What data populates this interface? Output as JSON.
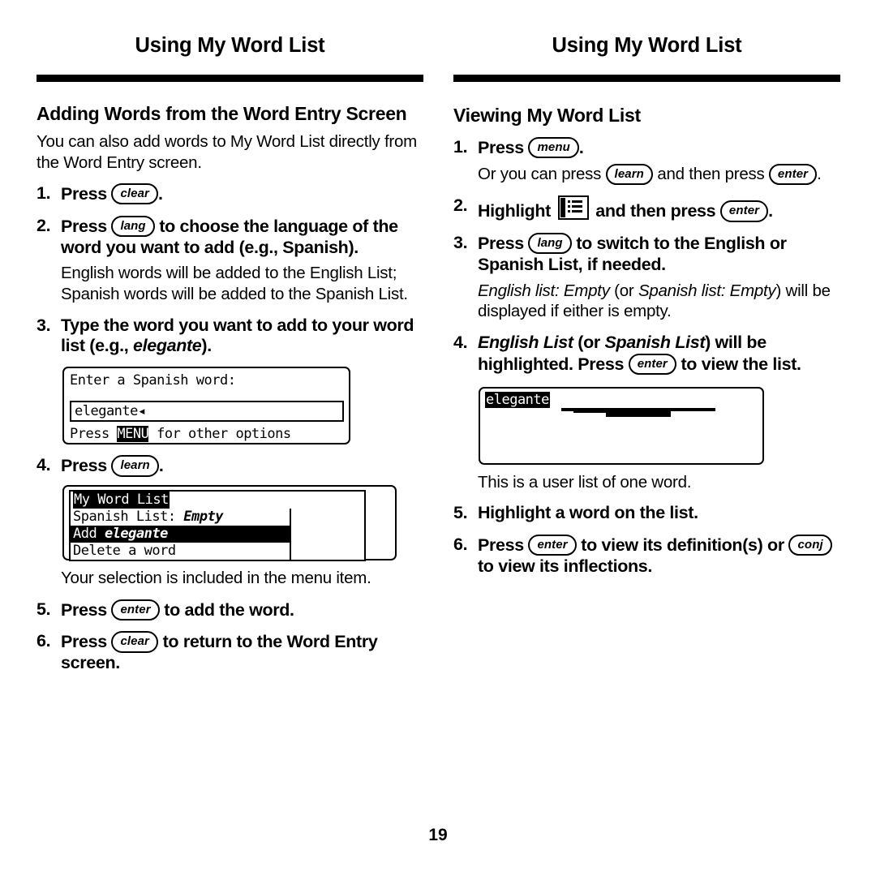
{
  "page": {
    "folio": "19",
    "running_head_left": "Using My Word List",
    "running_head_right": "Using My Word List"
  },
  "left_column": {
    "section_heading": "Adding Words from the Word Entry Screen",
    "intro": "You can also add words to My Word List directly from the Word Entry screen.",
    "steps": [
      {
        "num": "1.",
        "prefix": "Press ",
        "key": "clear",
        "suffix": "."
      },
      {
        "num": "2.",
        "prefix": "Press ",
        "key": "lang",
        "suffix": " to choose the language of the word you want to add (e.g., Spanish).",
        "note": "English words will be added to the English List; Spanish words will be added to the Spanish List."
      },
      {
        "num": "3.",
        "prefix": "Type the word you want to add to your word list (e.g., ",
        "italic": "elegante",
        "suffix": ")."
      },
      {
        "num": "4.",
        "prefix": "Press ",
        "key": "learn",
        "suffix": "."
      },
      {
        "num": "5.",
        "prefix": "Press ",
        "key": "enter",
        "suffix": " to add the word."
      },
      {
        "num": "6.",
        "prefix": "Press ",
        "key": "clear",
        "suffix": " to return to the Word Entry screen."
      }
    ],
    "caption_menu": "Your selection is included in the menu item.",
    "screen_word_entry": {
      "prompt": "Enter a Spanish word:",
      "field_value": "elegante◂",
      "footer_before": "Press ",
      "footer_key": "MENU",
      "footer_after": " for other options"
    },
    "screen_menu": {
      "title": "My Word List",
      "items": [
        {
          "label_before": "Spanish List: ",
          "label_italic": "Empty",
          "selected": false
        },
        {
          "label_before": "Add ",
          "label_italic": "elegante",
          "selected": true
        },
        {
          "label_before": "Delete a word",
          "label_italic": "",
          "selected": false
        }
      ]
    }
  },
  "right_column": {
    "section_heading": "Viewing My Word List",
    "steps": [
      {
        "num": "1.",
        "prefix": "Press ",
        "key": "menu",
        "suffix": ".",
        "note_a": "Or you can press ",
        "note_key1": "learn",
        "note_b": " and then press ",
        "note_key2": "enter",
        "note_c": "."
      },
      {
        "num": "2.",
        "prefix": "Highlight ",
        "icon": "word-list-icon",
        "middle": " and then press ",
        "key": "enter",
        "suffix": "."
      },
      {
        "num": "3.",
        "prefix": "Press ",
        "key": "lang",
        "suffix": " to switch to the English or Spanish List, if needed.",
        "note_i1": "English list: Empty",
        "note_n1": " (or ",
        "note_i2": "Spanish list: Empty",
        "note_n2": ") will be displayed if either is empty."
      },
      {
        "num": "4.",
        "bold_italic_1": "English List",
        "bold_1": " (or ",
        "bold_italic_2": "Spanish List",
        "bold_2": ") will be highlighted. Press ",
        "key": "enter",
        "bold_3": " to view the list."
      },
      {
        "num": "5.",
        "prefix": "Highlight a word on the list."
      },
      {
        "num": "6.",
        "prefix": "Press ",
        "key": "enter",
        "middle": " to view its definition(s) or ",
        "key2": "conj",
        "suffix": " to view its inflections."
      }
    ],
    "caption_list": "This is a user list of one word.",
    "screen_list": {
      "word": "elegante"
    }
  }
}
